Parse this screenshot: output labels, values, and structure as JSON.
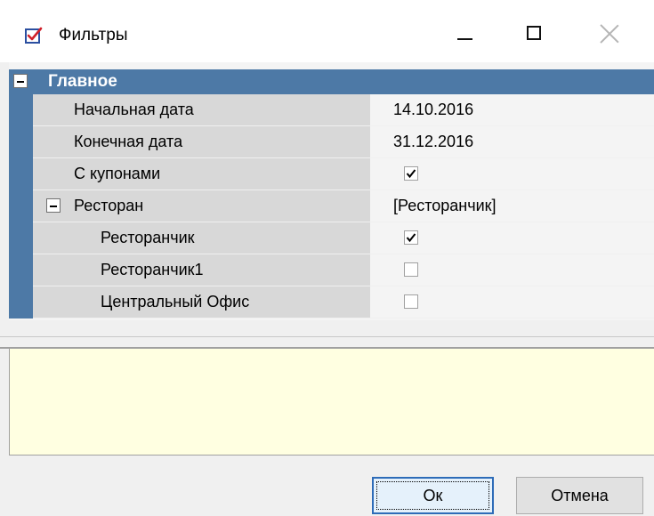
{
  "window": {
    "title": "Фильтры",
    "icon": "filter-checklist-icon"
  },
  "grid": {
    "category": "Главное",
    "category_expanded": true,
    "rows": [
      {
        "label": "Начальная дата",
        "value": "14.10.2016",
        "type": "text"
      },
      {
        "label": "Конечная дата",
        "value": "31.12.2016",
        "type": "text"
      },
      {
        "label": "С купонами",
        "checked": true,
        "type": "checkbox"
      },
      {
        "label": "Ресторан",
        "value": "[Ресторанчик]",
        "type": "group",
        "expanded": true
      },
      {
        "label": "Ресторанчик",
        "checked": true,
        "type": "checkbox"
      },
      {
        "label": "Ресторанчик1",
        "checked": false,
        "type": "checkbox"
      },
      {
        "label": "Центральный Офис",
        "checked": false,
        "type": "checkbox"
      }
    ]
  },
  "buttons": {
    "ok": "Ок",
    "cancel": "Отмена"
  },
  "colors": {
    "category_bar": "#4d79a6",
    "description_bg": "#ffffe1",
    "name_cell_bg": "#d8d8d8"
  }
}
